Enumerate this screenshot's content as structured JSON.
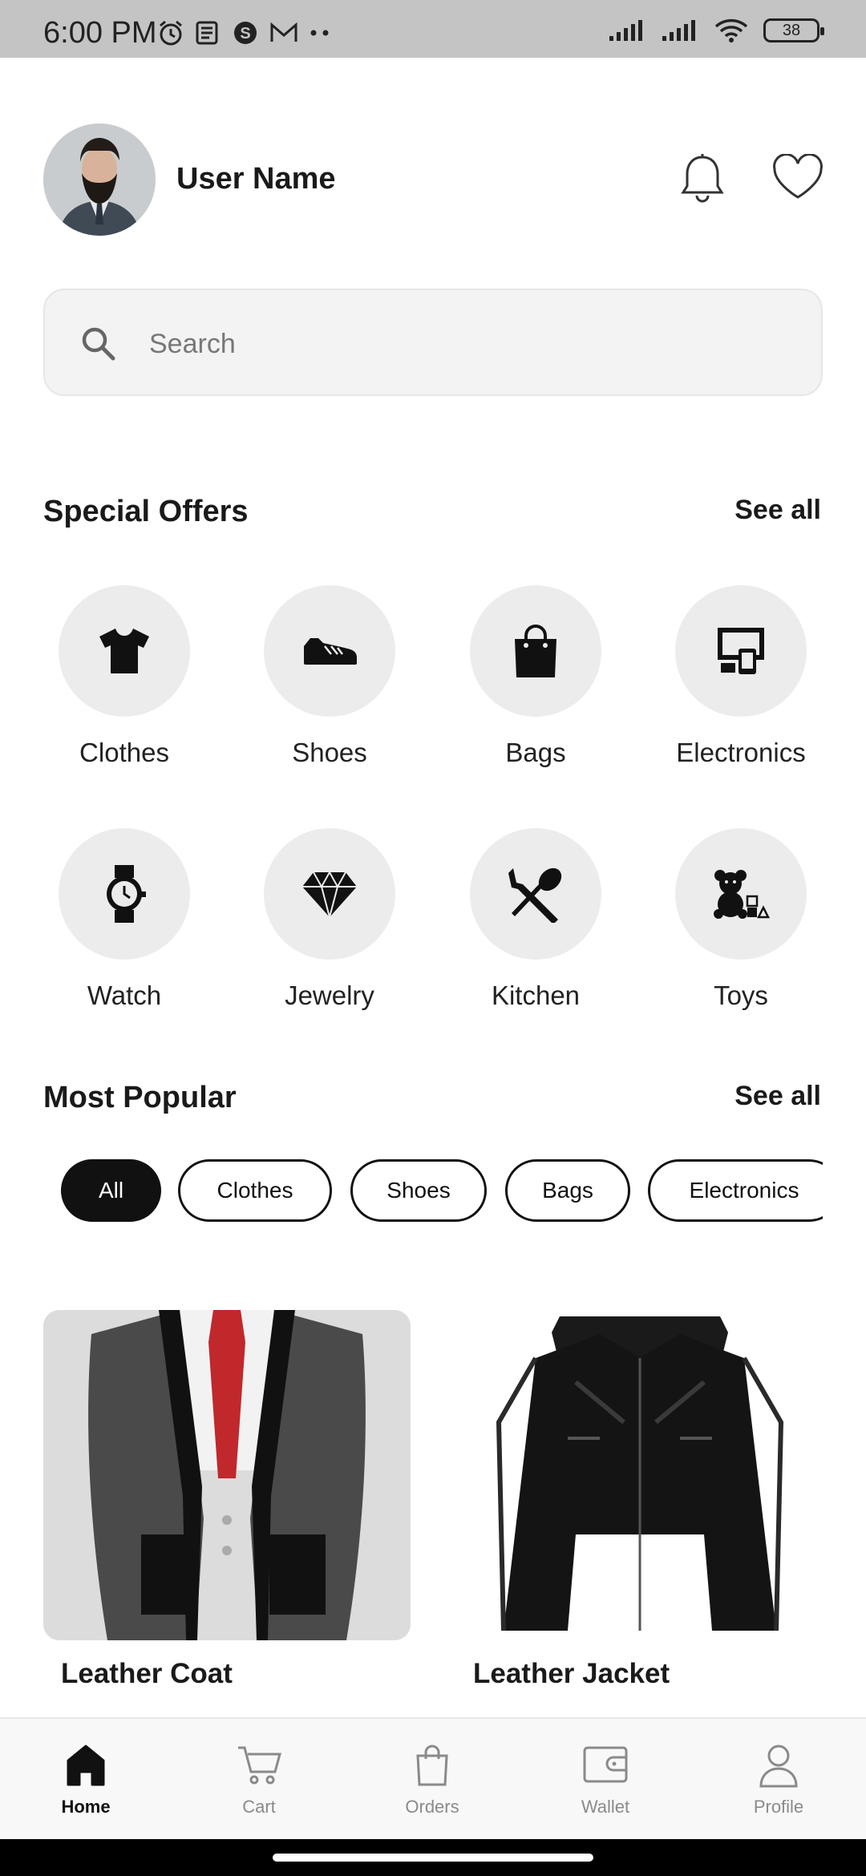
{
  "status_bar": {
    "time": "6:00 PM",
    "battery": "38"
  },
  "header": {
    "user_name": "User Name"
  },
  "search": {
    "placeholder": "Search"
  },
  "special_offers": {
    "title": "Special Offers",
    "see_all": "See all",
    "categories": [
      {
        "label": "Clothes",
        "icon": "tshirt-icon"
      },
      {
        "label": "Shoes",
        "icon": "shoe-icon"
      },
      {
        "label": "Bags",
        "icon": "bag-icon"
      },
      {
        "label": "Electronics",
        "icon": "devices-icon"
      },
      {
        "label": "Watch",
        "icon": "watch-icon"
      },
      {
        "label": "Jewelry",
        "icon": "diamond-icon"
      },
      {
        "label": "Kitchen",
        "icon": "utensils-icon"
      },
      {
        "label": "Toys",
        "icon": "teddy-bear-icon"
      }
    ]
  },
  "most_popular": {
    "title": "Most Popular",
    "see_all": "See all",
    "chips": [
      "All",
      "Clothes",
      "Shoes",
      "Bags",
      "Electronics"
    ],
    "active_chip": "All",
    "products": [
      {
        "name": "Leather Coat"
      },
      {
        "name": "Leather Jacket"
      }
    ]
  },
  "bottom_nav": {
    "items": [
      {
        "label": "Home",
        "icon": "home-icon",
        "active": true
      },
      {
        "label": "Cart",
        "icon": "cart-icon",
        "active": false
      },
      {
        "label": "Orders",
        "icon": "shopping-bag-icon",
        "active": false
      },
      {
        "label": "Wallet",
        "icon": "wallet-icon",
        "active": false
      },
      {
        "label": "Profile",
        "icon": "person-icon",
        "active": false
      }
    ]
  },
  "colors": {
    "accent": "#111111",
    "chip_bg": "#ececec",
    "nav_inactive": "#8a8a8a"
  }
}
